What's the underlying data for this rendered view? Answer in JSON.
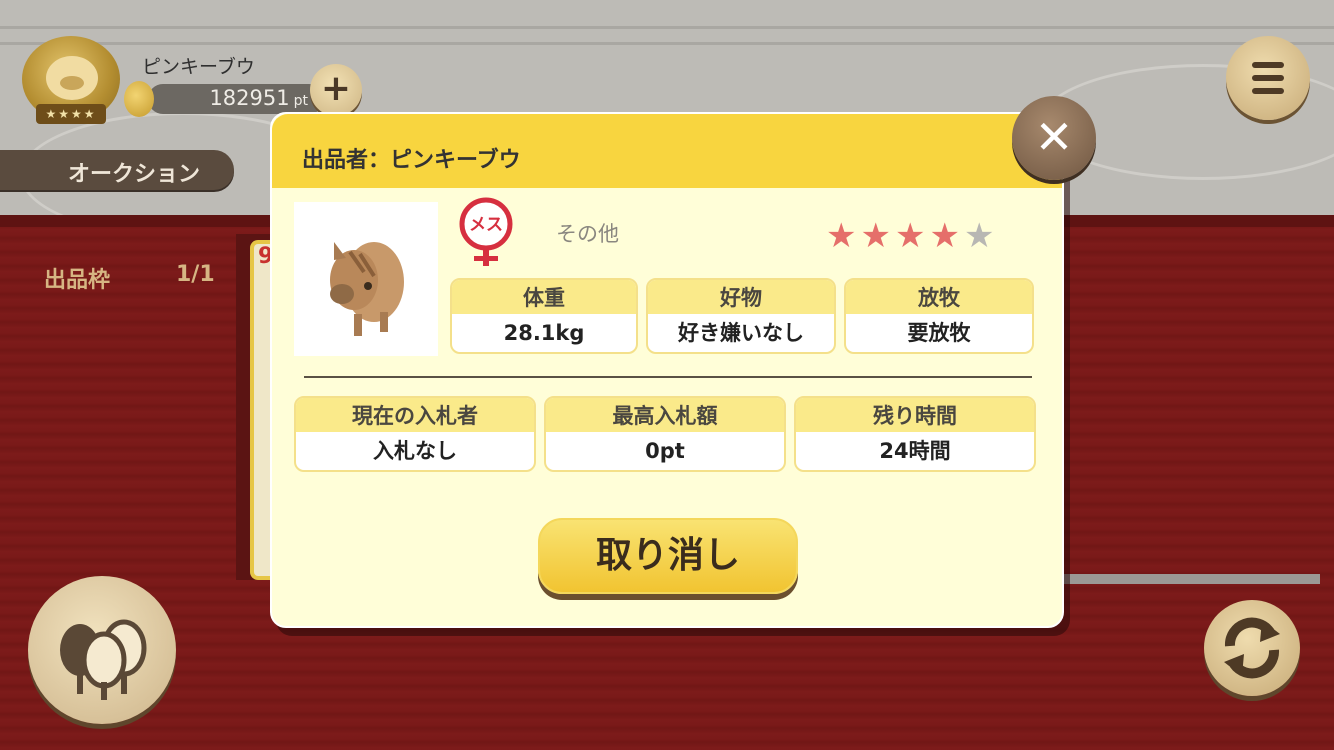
{
  "player": {
    "name": "ピンキーブウ",
    "points": "182951",
    "points_unit": "pt",
    "add_icon": "plus-icon",
    "medal_stars": "★★★★"
  },
  "header": {
    "tab_label": "オークション",
    "menu_icon": "hamburger-menu-icon"
  },
  "background": {
    "slot_label": "出品枠",
    "slot_value": "1/1",
    "card_number": "9"
  },
  "dialog": {
    "title": "出品者：ピンキーブウ",
    "gender": "メス",
    "category": "その他",
    "rating": 4,
    "rating_max": 5,
    "stats": [
      {
        "label": "体重",
        "value": "28.1kg"
      },
      {
        "label": "好物",
        "value": "好き嫌いなし"
      },
      {
        "label": "放牧",
        "value": "要放牧"
      }
    ],
    "auction": [
      {
        "label": "現在の入札者",
        "value": "入札なし"
      },
      {
        "label": "最高入札額",
        "value": "0pt"
      },
      {
        "label": "残り時間",
        "value": "24時間"
      }
    ],
    "cancel_label": "取り消し",
    "close_icon": "close-icon"
  },
  "colors": {
    "header_yellow": "#f8d53f",
    "panel_bg": "#fffed8",
    "star_on": "#e56f6a",
    "star_off": "#b8b7b3",
    "gender_red": "#d62f3f"
  }
}
